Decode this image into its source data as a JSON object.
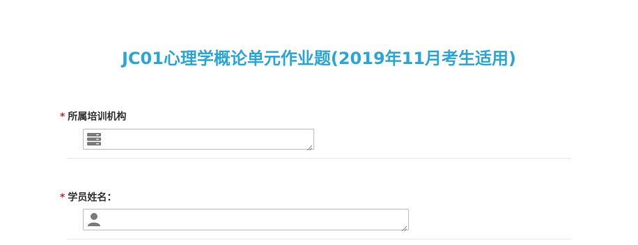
{
  "page": {
    "title": "JC01心理学概论单元作业题(2019年11月考生适用)"
  },
  "fields": [
    {
      "required_mark": "*",
      "label": "所属培训机构",
      "icon": "database-icon",
      "value": ""
    },
    {
      "required_mark": "*",
      "label": "学员姓名：",
      "icon": "user-icon",
      "value": ""
    }
  ],
  "colors": {
    "title": "#2aa6d8",
    "required": "#d9242c",
    "icon": "#7a7a7a"
  }
}
